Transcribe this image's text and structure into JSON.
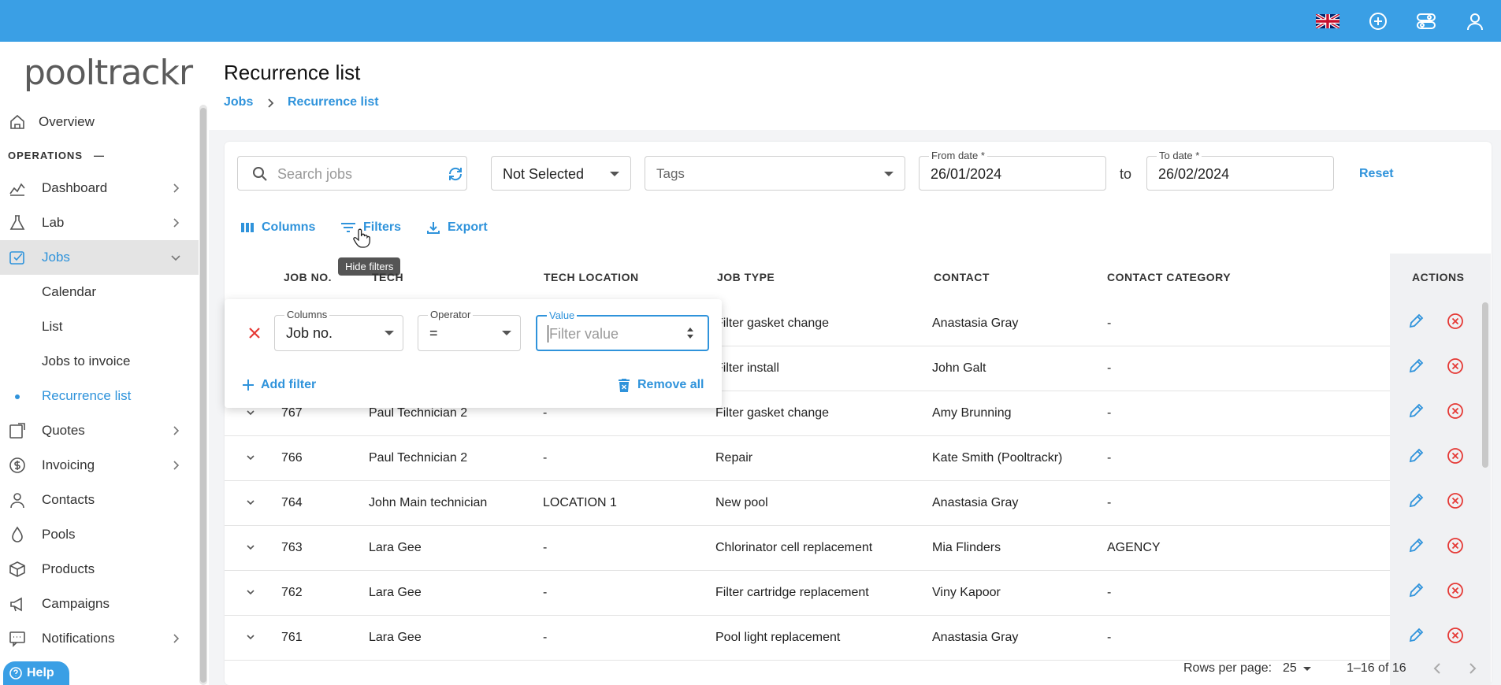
{
  "brand": {
    "logo_text": "pooltrackr",
    "accent": "#3a9fe5",
    "link": "#2f93db"
  },
  "topbar": {
    "icons": [
      "uk-flag-icon",
      "plus-circle-icon",
      "toggles-icon",
      "user-icon"
    ]
  },
  "sidebar": {
    "overview": "Overview",
    "section": "OPERATIONS",
    "section_toggle": "—",
    "items": [
      {
        "label": "Dashboard"
      },
      {
        "label": "Lab"
      },
      {
        "label": "Jobs"
      },
      {
        "label": "Quotes"
      },
      {
        "label": "Invoicing"
      },
      {
        "label": "Contacts"
      },
      {
        "label": "Pools"
      },
      {
        "label": "Products"
      },
      {
        "label": "Campaigns"
      },
      {
        "label": "Notifications"
      }
    ],
    "jobs_sub": [
      "Calendar",
      "List",
      "Jobs to invoice",
      "Recurrence list"
    ],
    "help": "Help"
  },
  "header": {
    "title": "Recurrence list",
    "breadcrumb": [
      "Jobs",
      "Recurrence list"
    ]
  },
  "filters": {
    "search_placeholder": "Search jobs",
    "status_select": "Not Selected",
    "tags_placeholder": "Tags",
    "from_label": "From date *",
    "from_value": "26/01/2024",
    "to_text": "to",
    "to_label": "To date *",
    "to_value": "26/02/2024",
    "reset": "Reset"
  },
  "toolbar": {
    "columns": "Columns",
    "filters": "Filters",
    "export": "Export",
    "tooltip": "Hide filters"
  },
  "filter_panel": {
    "columns_label": "Columns",
    "columns_value": "Job no.",
    "operator_label": "Operator",
    "operator_value": "=",
    "value_label": "Value",
    "value_placeholder": "Filter value",
    "add_filter": "Add filter",
    "remove_all": "Remove all"
  },
  "table": {
    "headers": [
      "JOB NO.",
      "TECH",
      "TECH LOCATION",
      "JOB TYPE",
      "CONTACT",
      "CONTACT CATEGORY",
      "ACTIONS"
    ],
    "rows": [
      {
        "job": "",
        "tech": "",
        "loc": "",
        "type": "Filter gasket change",
        "contact": "Anastasia Gray",
        "cat": "-"
      },
      {
        "job": "",
        "tech": "",
        "loc": "",
        "type": "Filter install",
        "contact": "John Galt",
        "cat": "-"
      },
      {
        "job": "767",
        "tech": "Paul Technician 2",
        "loc": "-",
        "type": "Filter gasket change",
        "contact": "Amy Brunning",
        "cat": "-"
      },
      {
        "job": "766",
        "tech": "Paul Technician 2",
        "loc": "-",
        "type": "Repair",
        "contact": "Kate Smith (Pooltrackr)",
        "cat": "-"
      },
      {
        "job": "764",
        "tech": "John Main technician",
        "loc": "LOCATION 1",
        "type": "New pool",
        "contact": "Anastasia Gray",
        "cat": "-"
      },
      {
        "job": "763",
        "tech": "Lara Gee",
        "loc": "-",
        "type": "Chlorinator cell replacement",
        "contact": "Mia Flinders",
        "cat": "AGENCY"
      },
      {
        "job": "762",
        "tech": "Lara Gee",
        "loc": "-",
        "type": "Filter cartridge replacement",
        "contact": "Viny Kapoor",
        "cat": "-"
      },
      {
        "job": "761",
        "tech": "Lara Gee",
        "loc": "-",
        "type": "Pool light replacement",
        "contact": "Anastasia Gray",
        "cat": "-"
      }
    ]
  },
  "pagination": {
    "rows_label": "Rows per page:",
    "rows_value": "25",
    "range": "1–16 of 16"
  }
}
